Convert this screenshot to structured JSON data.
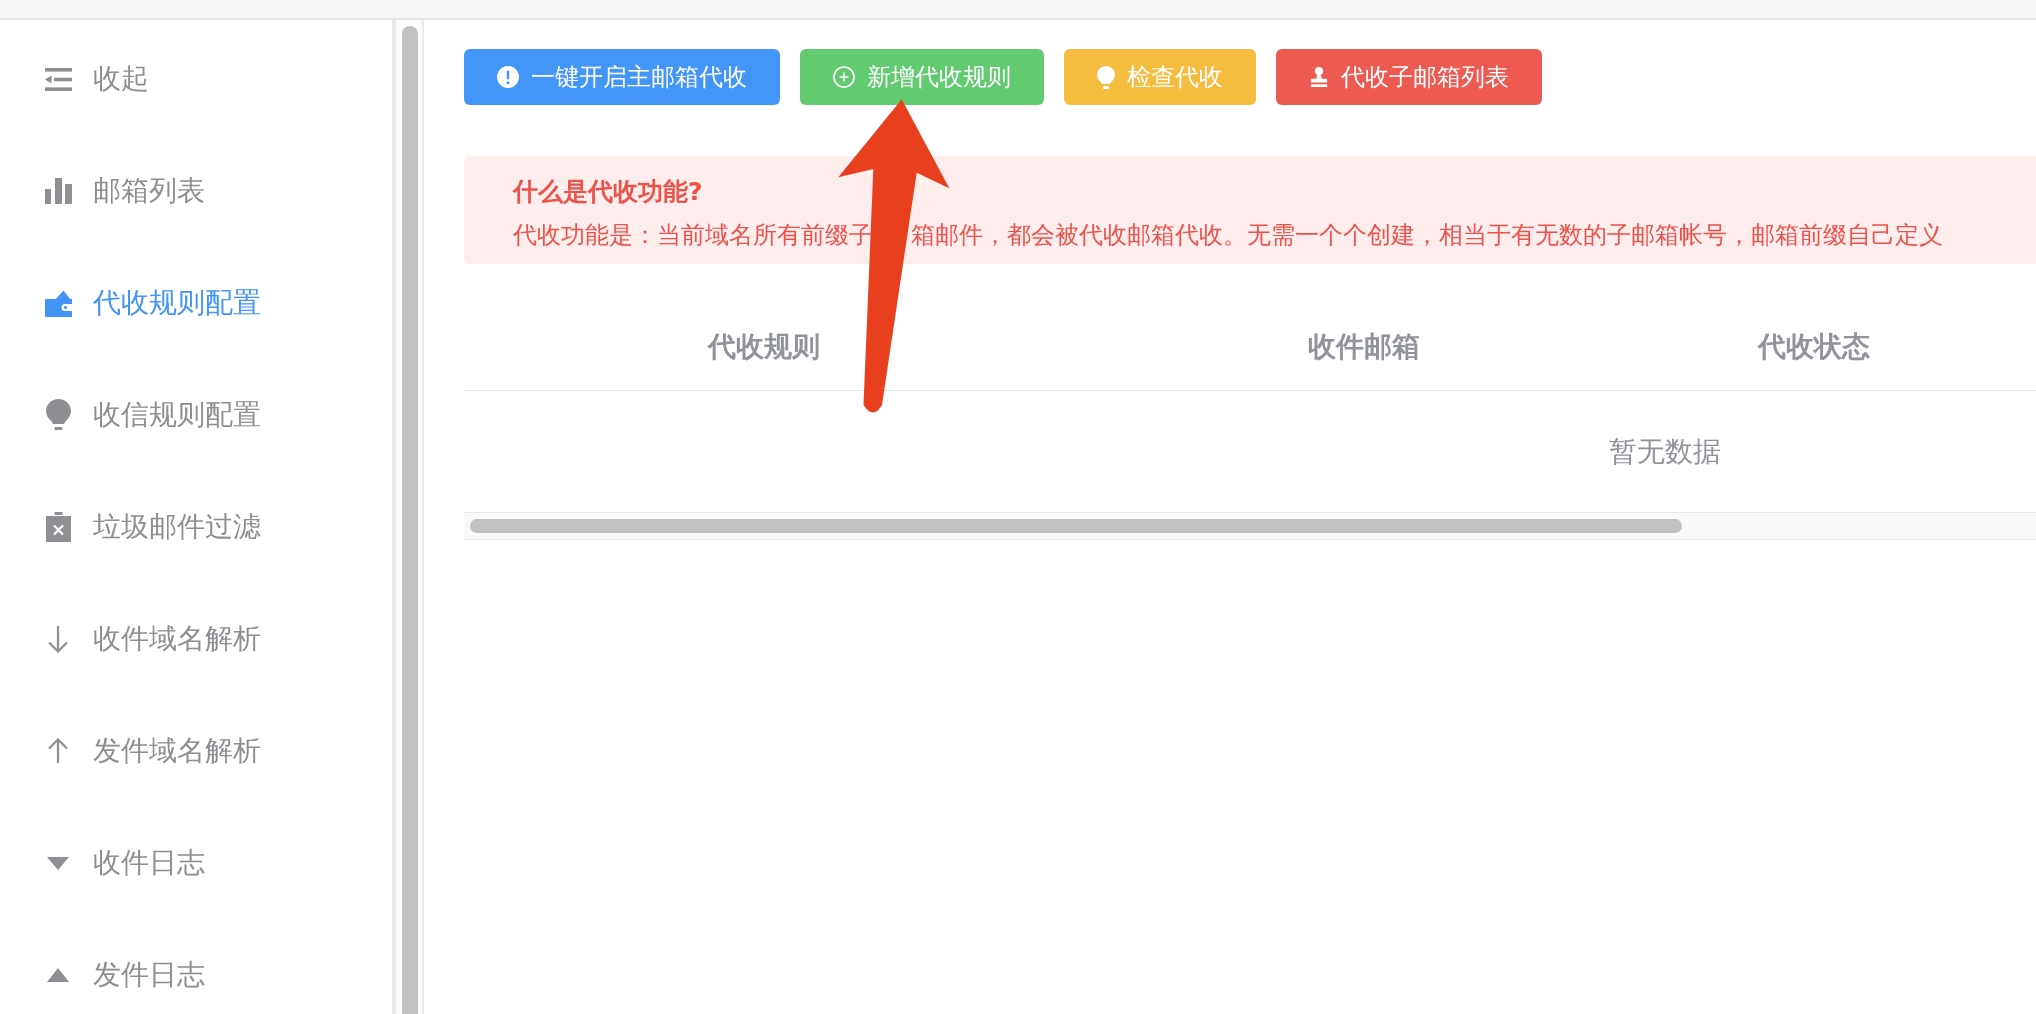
{
  "sidebar": {
    "items": [
      {
        "label": "收起",
        "selected": false
      },
      {
        "label": "邮箱列表",
        "selected": false
      },
      {
        "label": "代收规则配置",
        "selected": true
      },
      {
        "label": "收信规则配置",
        "selected": false
      },
      {
        "label": "垃圾邮件过滤",
        "selected": false
      },
      {
        "label": "收件域名解析",
        "selected": false
      },
      {
        "label": "发件域名解析",
        "selected": false
      },
      {
        "label": "收件日志",
        "selected": false
      },
      {
        "label": "发件日志",
        "selected": false
      }
    ]
  },
  "toolbar": {
    "buttons": [
      {
        "label": "一键开启主邮箱代收",
        "kind": "primary"
      },
      {
        "label": "新增代收规则",
        "kind": "success"
      },
      {
        "label": "检查代收",
        "kind": "warning"
      },
      {
        "label": "代收子邮箱列表",
        "kind": "danger"
      }
    ]
  },
  "notice": {
    "title": "什么是代收功能?",
    "text_segments": [
      "代收功能是：当前域名所有前缀子",
      "箱邮件，都会被代收邮箱代收。无需一个个创建，相当于有无数的子邮箱帐号，邮箱前缀自己定义"
    ]
  },
  "table": {
    "columns": [
      "代收规则",
      "收件邮箱",
      "代收状态"
    ],
    "empty_text": "暂无数据"
  },
  "annotations": [
    {
      "kind": "arrow"
    }
  ]
}
